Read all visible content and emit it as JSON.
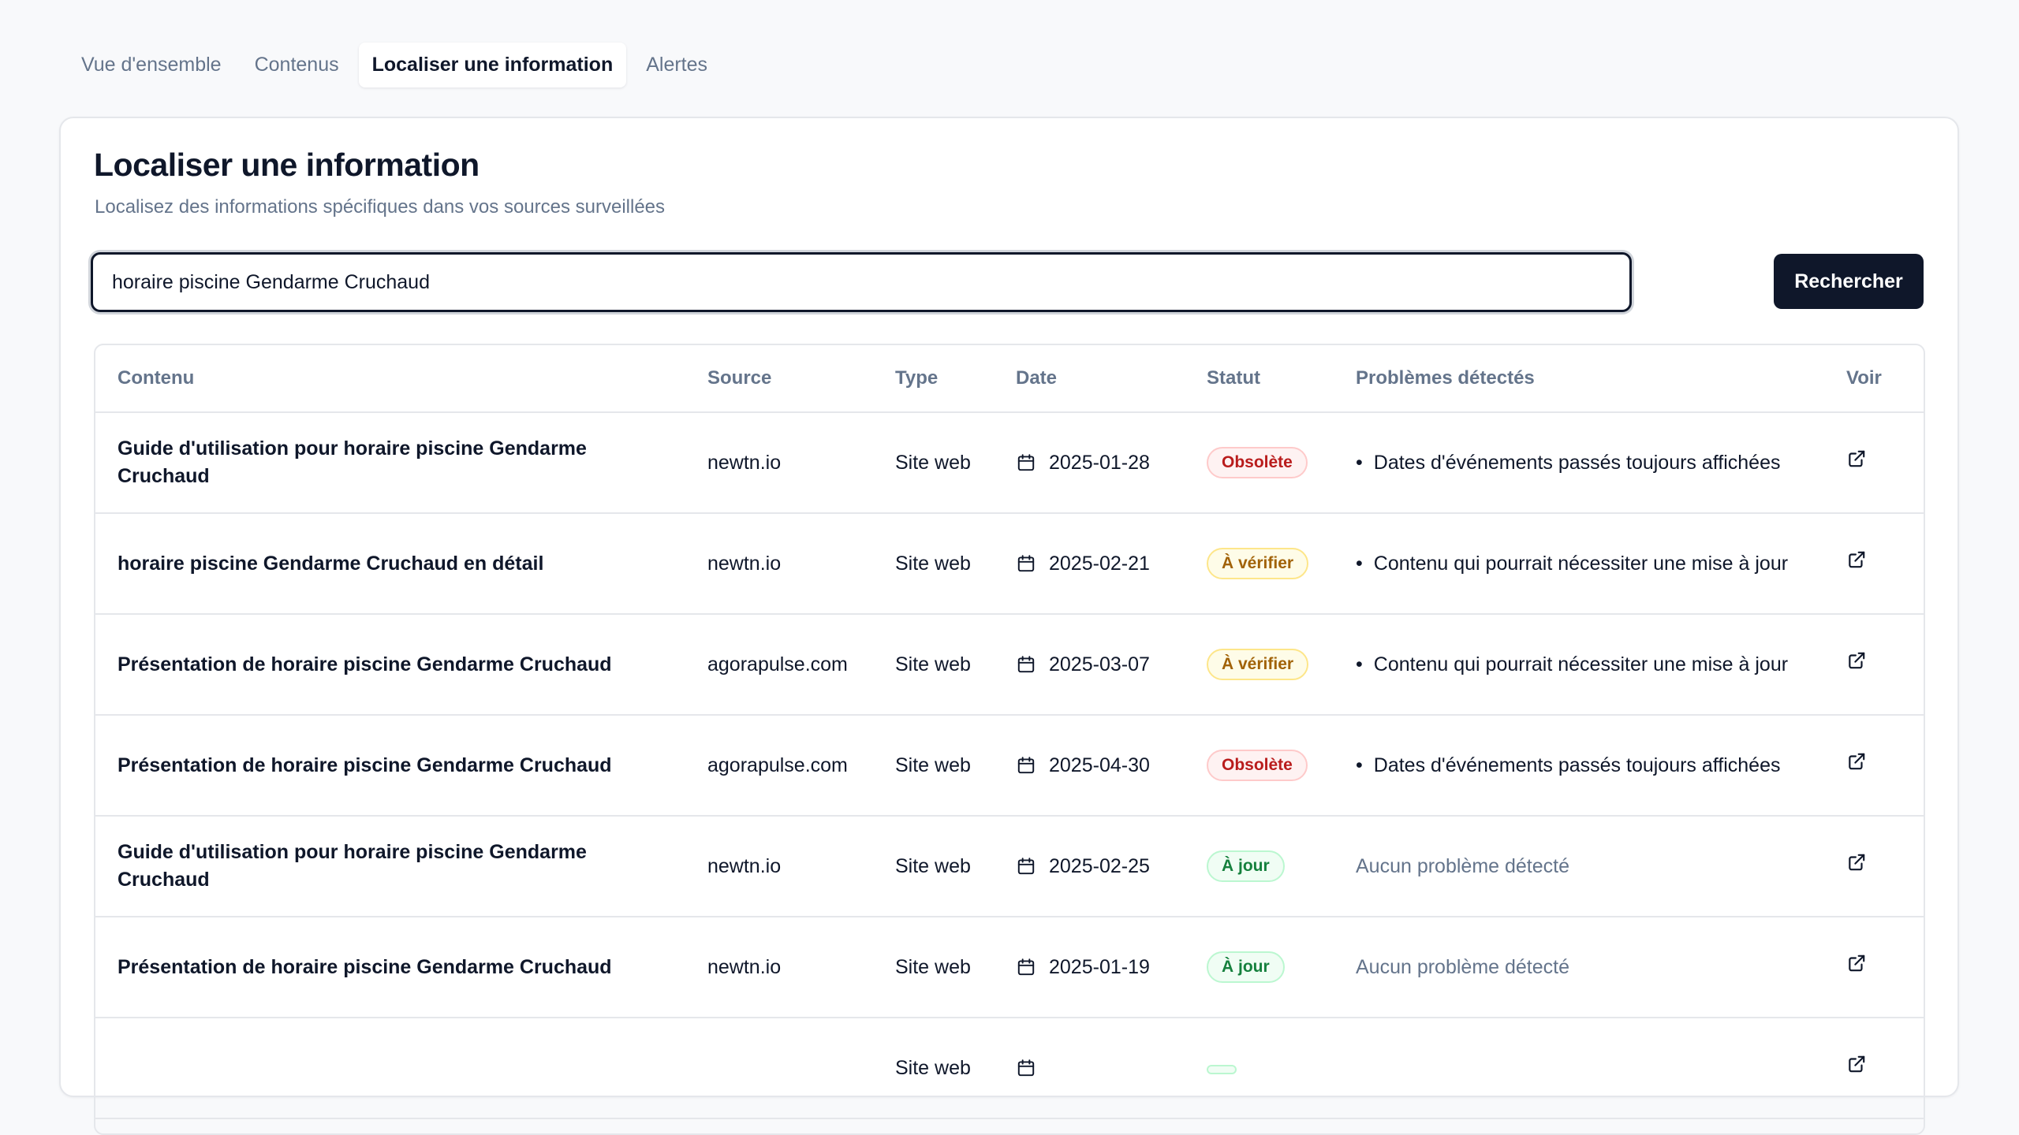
{
  "tabs": [
    {
      "label": "Vue d'ensemble"
    },
    {
      "label": "Contenus"
    },
    {
      "label": "Localiser une information",
      "active": true
    },
    {
      "label": "Alertes"
    }
  ],
  "card": {
    "title": "Localiser une information",
    "subtitle": "Localisez des informations spécifiques dans vos sources surveillées"
  },
  "search": {
    "value": "horaire piscine Gendarme Cruchaud ",
    "button_label": "Rechercher"
  },
  "table": {
    "headers": [
      "Contenu",
      "Source",
      "Type",
      "Date",
      "Statut",
      "Problèmes détectés",
      "Voir"
    ],
    "rows": [
      {
        "content": "Guide d'utilisation pour horaire piscine Gendarme Cruchaud",
        "source": "newtn.io",
        "type": "Site web",
        "date": "2025-01-28",
        "status": "Obsolète",
        "status_kind": "red",
        "issue": "Dates d'événements passés toujours affichées",
        "has_issue": true
      },
      {
        "content": "horaire piscine Gendarme Cruchaud en détail",
        "source": "newtn.io",
        "type": "Site web",
        "date": "2025-02-21",
        "status": "À vérifier",
        "status_kind": "amber",
        "issue": "Contenu qui pourrait nécessiter une mise à jour",
        "has_issue": true
      },
      {
        "content": "Présentation de horaire piscine Gendarme Cruchaud",
        "source": "agorapulse.com",
        "type": "Site web",
        "date": "2025-03-07",
        "status": "À vérifier",
        "status_kind": "amber",
        "issue": "Contenu qui pourrait nécessiter une mise à jour",
        "has_issue": true
      },
      {
        "content": "Présentation de horaire piscine Gendarme Cruchaud",
        "source": "agorapulse.com",
        "type": "Site web",
        "date": "2025-04-30",
        "status": "Obsolète",
        "status_kind": "red",
        "issue": "Dates d'événements passés toujours affichées",
        "has_issue": true
      },
      {
        "content": "Guide d'utilisation pour horaire piscine Gendarme Cruchaud",
        "source": "newtn.io",
        "type": "Site web",
        "date": "2025-02-25",
        "status": "À jour",
        "status_kind": "green",
        "issue": "Aucun problème détecté",
        "has_issue": false
      },
      {
        "content": "Présentation de horaire piscine Gendarme Cruchaud",
        "source": "newtn.io",
        "type": "Site web",
        "date": "2025-01-19",
        "status": "À jour",
        "status_kind": "green",
        "issue": "Aucun problème détecté",
        "has_issue": false
      },
      {
        "content": "",
        "source": "",
        "type": "Site web",
        "date": "",
        "status": "",
        "status_kind": "green",
        "issue": "",
        "has_issue": false
      }
    ]
  },
  "icons": {
    "date": "calendar-icon",
    "view": "external-link-icon"
  },
  "colors": {
    "primary": "#0f172a",
    "muted": "#64748b",
    "obsolete": "#b91c1c",
    "to_verify": "#a16207",
    "up_to_date": "#15803d"
  }
}
